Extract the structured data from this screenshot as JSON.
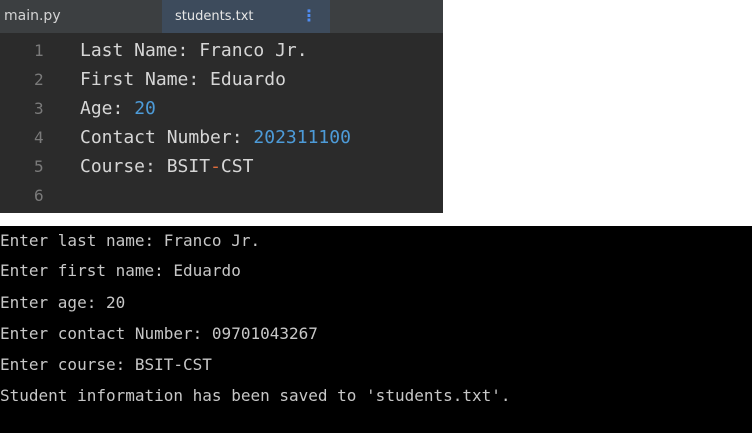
{
  "editor": {
    "tabs": [
      {
        "label": "main.py"
      },
      {
        "label": "students.txt",
        "active": true
      }
    ],
    "tab_menu_glyph": "⋮",
    "lines": [
      {
        "num": "1",
        "key": "Last Name: ",
        "value": "Franco Jr."
      },
      {
        "num": "2",
        "key": "First Name: ",
        "value": "Eduardo"
      },
      {
        "num": "3",
        "key": "Age: ",
        "value": "20"
      },
      {
        "num": "4",
        "key": "Contact Number: ",
        "value": "202311100"
      },
      {
        "num": "5",
        "key": "Course: ",
        "value_a": "BSIT",
        "value_dash": "-",
        "value_b": "CST"
      },
      {
        "num": "6"
      }
    ]
  },
  "terminal": {
    "lines": [
      "Enter last name: Franco Jr.",
      "Enter first name: Eduardo",
      "Enter age: 20",
      "Enter contact Number: 09701043267",
      "Enter course: BSIT-CST",
      "Student information has been saved to 'students.txt'."
    ]
  },
  "colors": {
    "editor_bg": "#2b2b2b",
    "tab_active_bg": "#3d4b5c",
    "number_blue": "#4d9bd8",
    "operator_orange": "#e06c3c",
    "terminal_bg": "#000000"
  }
}
